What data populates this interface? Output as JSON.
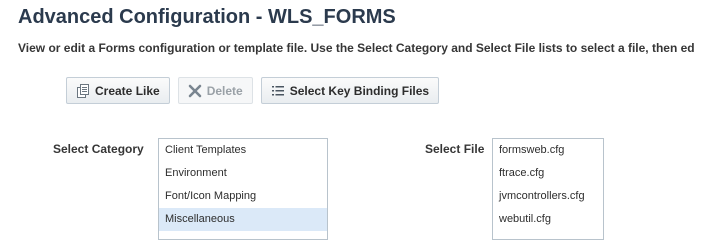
{
  "header": {
    "title": "Advanced Configuration - WLS_FORMS",
    "description": "View or edit a Forms configuration or template file. Use the Select Category and Select File lists to select a file, then ed"
  },
  "toolbar": {
    "create_like_label": "Create Like",
    "delete_label": "Delete",
    "key_binding_label": "Select Key Binding Files"
  },
  "category": {
    "label": "Select Category",
    "options": [
      "Client Templates",
      "Environment",
      "Font/Icon Mapping",
      "Miscellaneous"
    ],
    "selected": "Miscellaneous"
  },
  "file": {
    "label": "Select File",
    "options": [
      "formsweb.cfg",
      "ftrace.cfg",
      "jvmcontrollers.cfg",
      "webutil.cfg"
    ]
  },
  "colors": {
    "title": "#2b3a4d",
    "selected_row": "#dbe9f8",
    "delete_icon": "#7a8590"
  }
}
